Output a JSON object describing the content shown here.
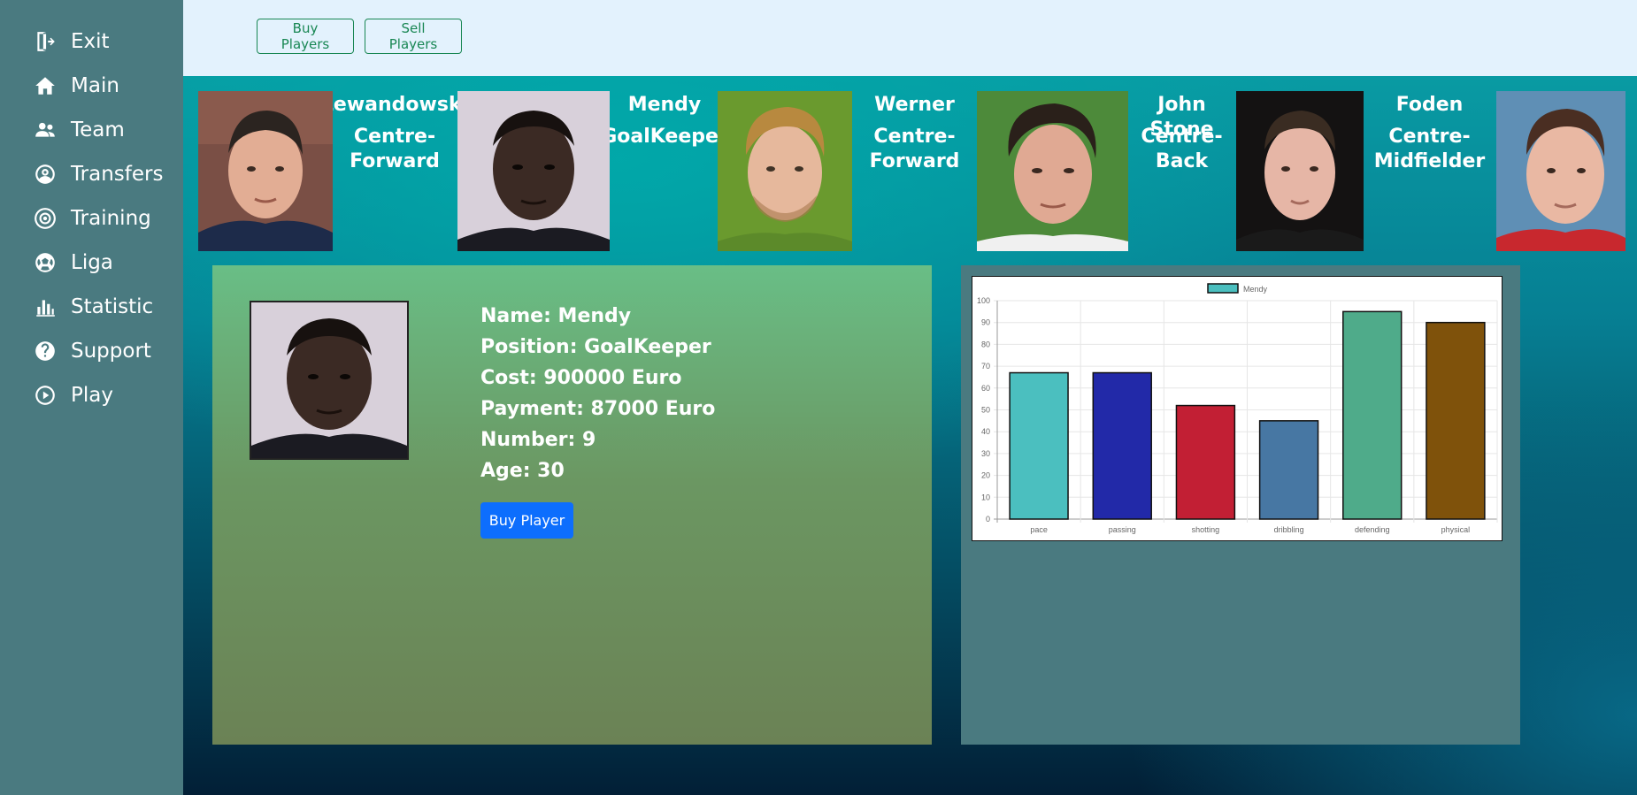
{
  "sidebar": {
    "items": [
      {
        "label": "Exit",
        "icon": "exit-icon"
      },
      {
        "label": "Main",
        "icon": "home-icon"
      },
      {
        "label": "Team",
        "icon": "team-icon"
      },
      {
        "label": "Transfers",
        "icon": "user-circle-icon"
      },
      {
        "label": "Training",
        "icon": "target-icon"
      },
      {
        "label": "Liga",
        "icon": "soccer-ball-icon"
      },
      {
        "label": "Statistic",
        "icon": "bar-chart-icon"
      },
      {
        "label": "Support",
        "icon": "help-icon"
      },
      {
        "label": "Play",
        "icon": "play-icon"
      }
    ]
  },
  "topbar": {
    "buy_label": "Buy Players",
    "sell_label": "Sell Players"
  },
  "players": [
    {
      "name": "Lewandowski",
      "position": "Centre-\nForward"
    },
    {
      "name": "Mendy",
      "position": "GoalKeeper"
    },
    {
      "name": "Werner",
      "position": "Centre-\nForward"
    },
    {
      "name": "John Stone",
      "position": "Centre-\nBack"
    },
    {
      "name": "Foden",
      "position": "Centre-\nMidfielder"
    },
    {
      "name": "",
      "position": ""
    }
  ],
  "selected": {
    "name_line": "Name: Mendy",
    "position_line": "Position: GoalKeeper",
    "cost_line": "Cost: 900000 Euro",
    "payment_line": "Payment: 87000 Euro",
    "number_line": "Number: 9",
    "age_line": "Age: 30",
    "buy_label": "Buy Player"
  },
  "colors": {
    "sidebar": "#4a7a80",
    "topbar": "#e3f2fd",
    "outline_button": "#198754",
    "primary_button": "#0d6efd"
  },
  "chart_data": {
    "type": "bar",
    "categories": [
      "pace",
      "passing",
      "shotting",
      "dribbling",
      "defending",
      "physical"
    ],
    "series": [
      {
        "name": "Mendy",
        "values": [
          67,
          67,
          52,
          45,
          95,
          90
        ]
      }
    ],
    "bar_colors": [
      "#4bbfbf",
      "#2229a8",
      "#c21f34",
      "#4777a3",
      "#4fab8a",
      "#7f520b"
    ],
    "ylim": [
      0,
      100
    ],
    "yticks": [
      0,
      10,
      20,
      30,
      40,
      50,
      60,
      70,
      80,
      90,
      100
    ],
    "legend_position": "top-center",
    "grid": true
  }
}
